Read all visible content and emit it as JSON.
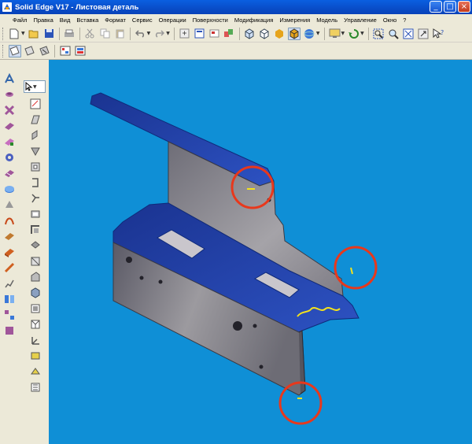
{
  "window": {
    "title": "Solid Edge V17 - Листовая деталь",
    "controls": [
      "_",
      "□",
      "×"
    ]
  },
  "menu": {
    "items": [
      "Файл",
      "Правка",
      "Вид",
      "Вставка",
      "Формат",
      "Сервис",
      "Операции",
      "Поверхности",
      "Модификация",
      "Измерения",
      "Модель",
      "Управление",
      "Окно",
      "?"
    ]
  },
  "colors": {
    "viewport_bg": "#0f8fd6",
    "part_face_top": "#1e3fa8",
    "part_face_side": "#8a8a93",
    "highlight_circle": "#e8381c",
    "selected_edge": "#f4e21c"
  },
  "toolbar1": {
    "icons": [
      "new-file-icon",
      "open-folder-icon",
      "save-icon",
      "print-icon",
      "cut-icon",
      "copy-icon",
      "paste-icon",
      "undo-icon",
      "redo-icon",
      "insert-icon",
      "properties-icon",
      "sheet-icon",
      "part-color-icon",
      "view-orient-icon",
      "box-view-icon",
      "shaded-icon",
      "shaded-edges-icon",
      "sphere-icon",
      "display-icon",
      "rotate-icon",
      "zoom-area-icon",
      "zoom-icon",
      "fit-icon",
      "pan-icon",
      "help-icon"
    ]
  },
  "toolbar2": {
    "icons": [
      "sketch-plane-icon",
      "sketch-view-icon",
      "sketch-edit-icon",
      "feature-tree-icon",
      "layer-icon"
    ]
  },
  "leftdock": {
    "col1_icons": [
      "pin-icon",
      "spring-icon",
      "cross-icon",
      "tab-icon",
      "flange-icon",
      "gear-icon",
      "contour-icon",
      "disk-icon",
      "cone-icon",
      "emboss-icon",
      "hem-icon",
      "plate-icon",
      "bend-icon",
      "corner-icon",
      "mirror-icon",
      "pattern-icon",
      "fold-icon"
    ],
    "col2_icons": [
      "select-icon",
      "sketch-icon",
      "line-icon",
      "arc-icon",
      "spline-icon",
      "rectangle-icon",
      "offset-icon",
      "fillet-icon",
      "chamfer-icon",
      "trim-icon",
      "extend-icon",
      "dimension-icon",
      "relation-icon",
      "box-icon",
      "plane-icon",
      "cube-icon",
      "axis-icon",
      "text-icon",
      "fill-icon",
      "pattern2-icon"
    ]
  }
}
